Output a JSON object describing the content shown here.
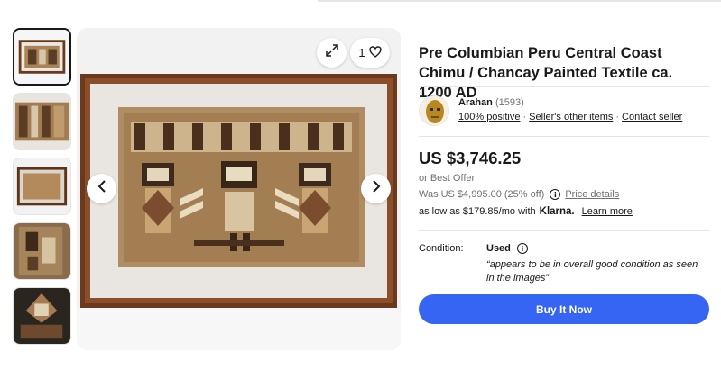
{
  "listing": {
    "title": "Pre Columbian Peru Central Coast Chimu / Chancay Painted Textile ca. 1200 AD"
  },
  "gallery": {
    "like_count": "1",
    "thumbnails": [
      "thumb-1",
      "thumb-2",
      "thumb-3",
      "thumb-4",
      "thumb-5"
    ]
  },
  "seller": {
    "name": "Arahan",
    "feedback_count": "(1593)",
    "positive": "100% positive",
    "other_items": "Seller's other items",
    "contact": "Contact seller",
    "separator": "·"
  },
  "pricing": {
    "price": "US $3,746.25",
    "best_offer": "or Best Offer",
    "was_label": "Was",
    "was_price": "US $4,995.00",
    "discount": "(25% off)",
    "price_details": "Price details",
    "klarna_prefix": "as low as $179.85/mo with",
    "klarna_brand": "Klarna.",
    "learn_more": "Learn more"
  },
  "condition": {
    "label": "Condition:",
    "value": "Used",
    "quote": "“appears to be in overall good condition as seen in the images”"
  },
  "actions": {
    "buy_now": "Buy It Now"
  },
  "colors": {
    "accent": "#3665f3",
    "frame": "#6b3a1e",
    "textile": "#b08c62"
  },
  "icons": {
    "expand": "expand-icon",
    "heart": "heart-icon",
    "prev": "chevron-left-icon",
    "next": "chevron-right-icon",
    "info": "info-icon"
  }
}
